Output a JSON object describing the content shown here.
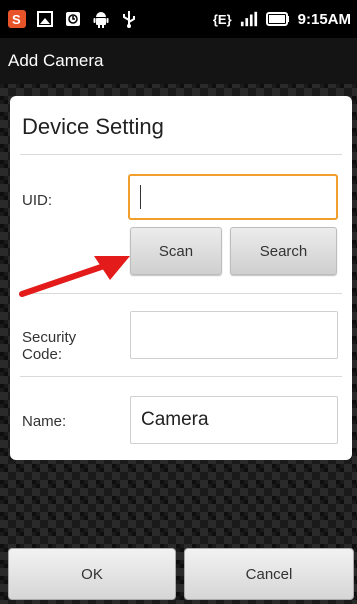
{
  "status_bar": {
    "icons": [
      "app-s-icon",
      "image-icon",
      "clock-icon",
      "android-icon",
      "usb-icon",
      "edge-data-icon",
      "signal-icon",
      "battery-icon"
    ],
    "network_label": "{E}",
    "time": "9:15AM"
  },
  "title_bar": {
    "title": "Add Camera"
  },
  "dialog": {
    "title": "Device Setting",
    "uid_label": "UID:",
    "uid_value": "",
    "scan_label": "Scan",
    "search_label": "Search",
    "security_label_line1": "Security",
    "security_label_line2": "Code:",
    "security_value": "",
    "name_label": "Name:",
    "name_value": "Camera"
  },
  "annotation": {
    "arrow_color": "#e31b1b"
  },
  "buttons": {
    "ok_label": "OK",
    "cancel_label": "Cancel"
  },
  "colors": {
    "focus_border": "#f19f2c",
    "dialog_bg": "#ffffff"
  }
}
